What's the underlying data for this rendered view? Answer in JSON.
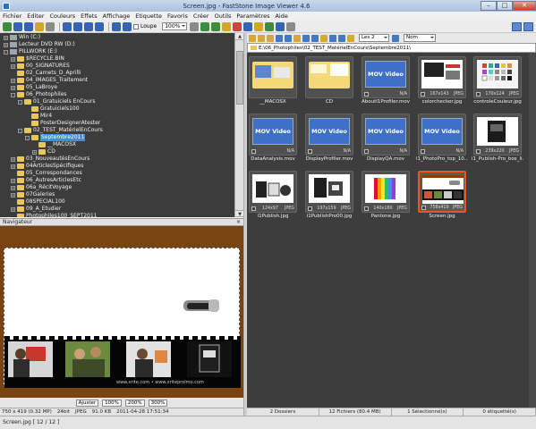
{
  "window": {
    "title": "Screen.jpg - FastStone Image Viewer 4.6",
    "minimize": "–",
    "maximize": "□",
    "close": "✕"
  },
  "menu": [
    "Fichier",
    "Editer",
    "Couleurs",
    "Effets",
    "Affichage",
    "Etiquette",
    "Favoris",
    "Créer",
    "Outils",
    "Paramètres",
    "Aide"
  ],
  "toolbar": {
    "loupe_label": "Loupe",
    "zoom_value": "100%"
  },
  "tree": [
    {
      "label": "Win (C:)",
      "level": 0,
      "icon": "drive",
      "expander": "+"
    },
    {
      "label": "Lecteur DVD RW (D:)",
      "level": 0,
      "icon": "drive",
      "expander": "+"
    },
    {
      "label": "PILLWORK (E:)",
      "level": 0,
      "icon": "drive",
      "expander": "-"
    },
    {
      "label": "$RECYCLE.BIN",
      "level": 1,
      "icon": "folder",
      "expander": "+"
    },
    {
      "label": "00_SIGNATURES",
      "level": 1,
      "icon": "folder",
      "expander": "+"
    },
    {
      "label": "02_Carnets_D_Aprilli",
      "level": 1,
      "icon": "folder",
      "expander": ""
    },
    {
      "label": "04_IMAGES_Traitement",
      "level": 1,
      "icon": "folder",
      "expander": "+"
    },
    {
      "label": "05_LaBroye",
      "level": 1,
      "icon": "folder",
      "expander": "+"
    },
    {
      "label": "06_Photophiles",
      "level": 1,
      "icon": "folder",
      "expander": "-"
    },
    {
      "label": "01_Gratuiciels EnCours",
      "level": 2,
      "icon": "folder",
      "expander": "-"
    },
    {
      "label": "Gratuiciels100",
      "level": 3,
      "icon": "folder",
      "expander": ""
    },
    {
      "label": "Mir4",
      "level": 3,
      "icon": "folder",
      "expander": ""
    },
    {
      "label": "PosterDesignerAtester",
      "level": 3,
      "icon": "folder",
      "expander": ""
    },
    {
      "label": "02_TEST_MatérielEnCours",
      "level": 2,
      "icon": "folder",
      "expander": "-"
    },
    {
      "label": "Septembre2011",
      "level": 3,
      "icon": "folder",
      "expander": "-",
      "selected": true
    },
    {
      "label": "__MACOSX",
      "level": 4,
      "icon": "folder",
      "expander": ""
    },
    {
      "label": "CD",
      "level": 4,
      "icon": "folder",
      "expander": "+"
    },
    {
      "label": "03_NouveautésEnCours",
      "level": 1,
      "icon": "folder",
      "expander": "+"
    },
    {
      "label": "04ArticlesSpécifiques",
      "level": 1,
      "icon": "folder",
      "expander": "+"
    },
    {
      "label": "05_Correspondances",
      "level": 1,
      "icon": "folder",
      "expander": ""
    },
    {
      "label": "06_AutresArticlesEtc",
      "level": 1,
      "icon": "folder",
      "expander": "+"
    },
    {
      "label": "06a_RécitVoyage",
      "level": 1,
      "icon": "folder",
      "expander": "+"
    },
    {
      "label": "07Galeries",
      "level": 1,
      "icon": "folder",
      "expander": "+"
    },
    {
      "label": "08SPECIAL100",
      "level": 1,
      "icon": "folder",
      "expander": ""
    },
    {
      "label": "09_A_Etudier",
      "level": 1,
      "icon": "folder",
      "expander": "+"
    },
    {
      "label": "Photophiles100_SEPT2011",
      "level": 1,
      "icon": "folder",
      "expander": ""
    }
  ],
  "navigator": {
    "title": "Navigateur",
    "close": "×",
    "caption": "www.xrite.com  •  www.xriteprolmo.com",
    "buttons": [
      "Ajuster",
      "100%",
      "200%",
      "300%"
    ]
  },
  "left_status": [
    "750 x 419 (0.32 MP)",
    "24bit",
    "JPEG",
    "91.0 KB",
    "2011-04-28 17:51:34"
  ],
  "right_toolbar": {
    "view_select": "Les 2",
    "sort_select": "Nom"
  },
  "path": "E:\\06_Photophiles\\02_TEST_MatérielEnCours\\Septembre2011\\",
  "files": [
    {
      "name": "__MACOSX",
      "type": "folder",
      "dims": "",
      "fmt": ""
    },
    {
      "name": "CD",
      "type": "folder2",
      "dims": "",
      "fmt": ""
    },
    {
      "name": "AboutI1Profiler.mov",
      "type": "mov",
      "mov_label": "MOV Video",
      "dims": "",
      "fmt": "N/A"
    },
    {
      "name": "colorchecker.jpg",
      "type": "img1",
      "dims": "167x143",
      "fmt": "JPEG"
    },
    {
      "name": "controleCouleur.jpg",
      "type": "img2",
      "dims": "170x124",
      "fmt": "JPEG"
    },
    {
      "name": "DataAnalysis.mov",
      "type": "mov",
      "mov_label": "MOV Video",
      "dims": "",
      "fmt": "N/A"
    },
    {
      "name": "DisplayProfiler.mov",
      "type": "mov",
      "mov_label": "MOV Video",
      "dims": "",
      "fmt": "N/A"
    },
    {
      "name": "DisplayQA.mov",
      "type": "mov",
      "mov_label": "MOV Video",
      "dims": "",
      "fmt": "N/A"
    },
    {
      "name": "i1_PhotoPro_top_10....",
      "type": "mov",
      "mov_label": "MOV Video",
      "dims": "",
      "fmt": "N/A"
    },
    {
      "name": "i1_Publish-Pro_box_li...",
      "type": "img3",
      "dims": "239x220",
      "fmt": "JPEG"
    },
    {
      "name": "i1Publish.jpg",
      "type": "img4",
      "dims": "124x97",
      "fmt": "JPEG"
    },
    {
      "name": "i1PublishPro00.jpg",
      "type": "img5",
      "dims": "197x159",
      "fmt": "JPEG"
    },
    {
      "name": "Pantone.jpg",
      "type": "img6",
      "dims": "140x180",
      "fmt": "JPEG"
    },
    {
      "name": "Screen.jpg",
      "type": "img7",
      "dims": "758x419",
      "fmt": "JPEG",
      "active": true
    }
  ],
  "right_status": [
    "2 Dossiers",
    "12 Fichiers (80.4 MB)",
    "1 Sélectionné(s)",
    "0 étiquetté(s)"
  ],
  "footer": "Screen.jpg [ 12 / 12 ]",
  "colors": {
    "panel_bg": "#3d3d3d",
    "selection": "#e9581f",
    "mov_blue": "#3f70c8",
    "folder": "#e9c75a",
    "nav_bg": "#7a4312"
  }
}
